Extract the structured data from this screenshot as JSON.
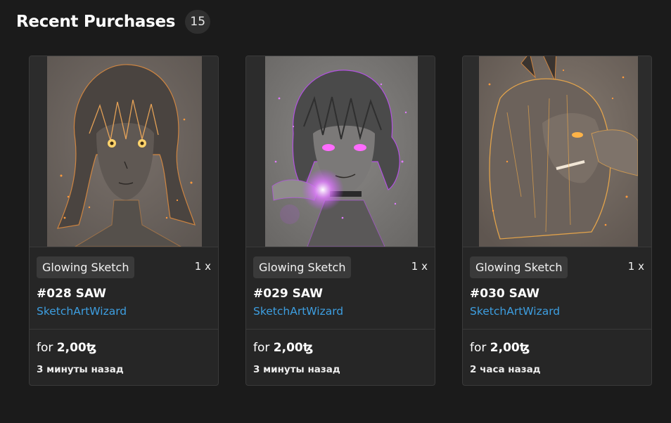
{
  "header": {
    "title": "Recent Purchases",
    "count": "15"
  },
  "cards": [
    {
      "tag": "Glowing Sketch",
      "qty": "1 x",
      "title": "#028 SAW",
      "creator": "SketchArtWizard",
      "price_prefix": "for ",
      "price_value": "2,00ꜩ",
      "time": "3 минуты назад",
      "glow_color": "#ff9a3c",
      "eye_color": "#ffd36b"
    },
    {
      "tag": "Glowing Sketch",
      "qty": "1 x",
      "title": "#029 SAW",
      "creator": "SketchArtWizard",
      "price_prefix": "for ",
      "price_value": "2,00ꜩ",
      "time": "3 минуты назад",
      "glow_color": "#c54dff",
      "eye_color": "#ff6bff"
    },
    {
      "tag": "Glowing Sketch",
      "qty": "1 x",
      "title": "#030 SAW",
      "creator": "SketchArtWizard",
      "price_prefix": "for ",
      "price_value": "2,00ꜩ",
      "time": "2 часа назад",
      "glow_color": "#ff9a3c",
      "eye_color": "#ffb347"
    }
  ],
  "colors": {
    "background": "#1b1b1b",
    "card": "#262626",
    "link": "#3d9ee0",
    "badge": "#2f2f2f"
  }
}
